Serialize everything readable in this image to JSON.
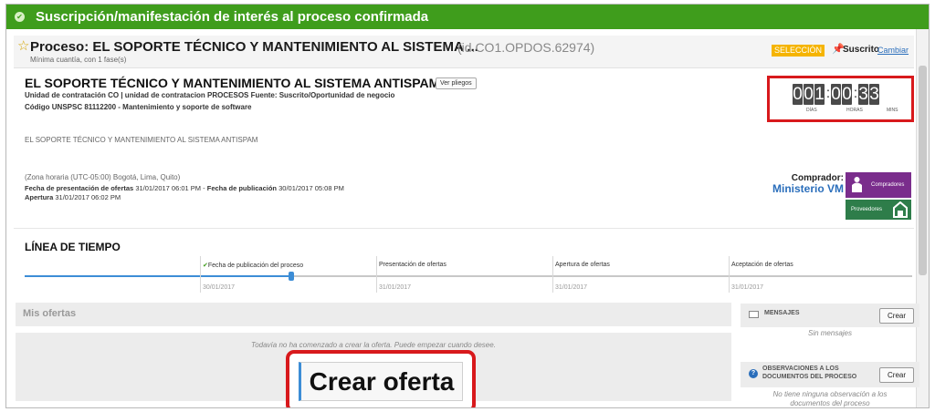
{
  "banner": {
    "text": "Suscripción/manifestación de interés al proceso confirmada"
  },
  "process_header": {
    "title": "Proceso: EL SOPORTE TÉCNICO Y MANTENIMIENTO AL SISTEMA ...",
    "id": "(id.CO1.OPDOS.62974)",
    "subtitle": "Mínima cuantía, con 1 fase(s)",
    "badge": "SELECCIÓN",
    "subscribed_label": "Suscrito",
    "change_link": "Cambiar"
  },
  "details": {
    "title": "EL SOPORTE TÉCNICO Y MANTENIMIENTO AL SISTEMA ANTISPAM",
    "ver_pliegos": "Ver pliegos",
    "meta_line1": "Unidad de contratación CO | unidad de contratacion PROCESOS Fuente: Suscrito/Oportunidad de negocio",
    "meta_line2": "Código UNSPSC 81112200 - Mantenimiento y soporte de software",
    "description": "EL SOPORTE TÉCNICO Y MANTENIMIENTO AL SISTEMA ANTISPAM",
    "timezone": "(Zona horaria (UTC-05:00) Bogotá, Lima, Quito)",
    "presentacion_label": "Fecha de presentación de ofertas",
    "presentacion_value": "31/01/2017 06:01 PM",
    "separator": "-",
    "publicacion_label": "Fecha de publicación",
    "publicacion_value": "30/01/2017 05:08 PM",
    "apertura_label": "Apertura",
    "apertura_value": "31/01/2017 06:02 PM",
    "comprador_label": "Comprador:",
    "comprador_name": "Ministerio VM",
    "logo_top_text": "Compradores",
    "logo_bottom_text": "Proveedores"
  },
  "countdown": {
    "days": [
      "0",
      "0",
      "1"
    ],
    "hours": [
      "0",
      "0"
    ],
    "mins": [
      "3",
      "3"
    ],
    "colon": ":",
    "days_label": "DÍAS",
    "hours_label": "HORAS",
    "mins_label": "MINS"
  },
  "timeline": {
    "title": "LÍNEA DE TIEMPO",
    "progress": 0.3,
    "steps": [
      {
        "label": "Fecha de publicación del proceso",
        "date": "30/01/2017",
        "done": true
      },
      {
        "label": "Presentación de ofertas",
        "date": "31/01/2017",
        "done": false
      },
      {
        "label": "Apertura de ofertas",
        "date": "31/01/2017",
        "done": false
      },
      {
        "label": "Aceptación de ofertas",
        "date": "31/01/2017",
        "done": false
      }
    ]
  },
  "ofertas": {
    "title": "Mis ofertas",
    "empty_message": "Todavía no ha comenzado a crear la oferta. Puede empezar cuando desee.",
    "create_button": "Crear oferta"
  },
  "mensajes": {
    "title": "MENSAJES",
    "create_button": "Crear",
    "empty": "Sin mensajes"
  },
  "observaciones": {
    "title_line1": "OBSERVACIONES A LOS",
    "title_line2": "DOCUMENTOS DEL PROCESO",
    "create_button": "Crear",
    "empty_line1": "No tiene ninguna observación a los",
    "empty_line2": "documentos del proceso"
  },
  "colors": {
    "banner_green": "#3f9d1c",
    "highlight_red": "#d8191c",
    "link_blue": "#2a6ebb",
    "badge_orange": "#f5b400",
    "timeline_blue": "#3c8dd6"
  },
  "icons": {
    "banner": "check-circle-icon",
    "favorite": "star-icon",
    "subscribed": "pushpin-icon",
    "mensajes": "envelope-icon",
    "observaciones": "question-icon",
    "timeline_done": "check-icon"
  }
}
